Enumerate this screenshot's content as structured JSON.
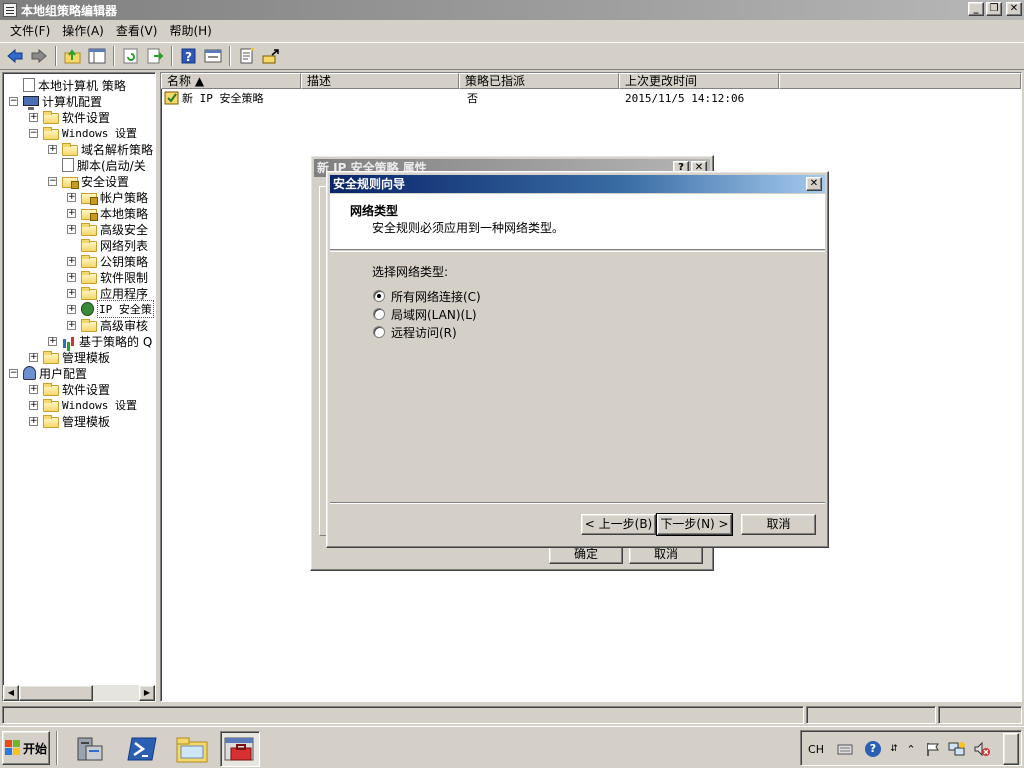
{
  "window": {
    "title": "本地组策略编辑器",
    "minimize": "_",
    "restore": "❐",
    "close": "✕"
  },
  "menu": [
    "文件(F)",
    "操作(A)",
    "查看(V)",
    "帮助(H)"
  ],
  "toolbar": {
    "buttons": [
      "back-icon",
      "forward-icon",
      "up-folder-icon",
      "show-hide-tree-icon",
      "refresh-icon",
      "export-icon",
      "help-icon",
      "properties-icon",
      "new-policy-icon",
      "assign-icon"
    ],
    "colors": {
      "blue": "#2f6ccc",
      "green": "#2aa02a",
      "yellow": "#f5d86a"
    }
  },
  "tree": [
    {
      "label": "本地计算机 策略",
      "icon": "doc-icon",
      "level": 0,
      "expander": ""
    },
    {
      "label": "计算机配置",
      "icon": "computer-icon",
      "level": 0,
      "expander": "−"
    },
    {
      "label": "软件设置",
      "icon": "folder-icon",
      "level": 1,
      "expander": "+"
    },
    {
      "label": "Windows 设置",
      "icon": "folder-icon",
      "level": 1,
      "expander": "−"
    },
    {
      "label": "域名解析策略",
      "icon": "folder-icon",
      "level": 2,
      "expander": "+"
    },
    {
      "label": "脚本(启动/关",
      "icon": "script-icon",
      "level": 2,
      "expander": ""
    },
    {
      "label": "安全设置",
      "icon": "security-folder-icon",
      "level": 2,
      "expander": "−"
    },
    {
      "label": "帐户策略",
      "icon": "security-folder-icon",
      "level": 3,
      "expander": "+"
    },
    {
      "label": "本地策略",
      "icon": "security-folder-icon",
      "level": 3,
      "expander": "+"
    },
    {
      "label": "高级安全",
      "icon": "folder-icon",
      "level": 3,
      "expander": "+"
    },
    {
      "label": "网络列表",
      "icon": "folder-icon",
      "level": 3,
      "expander": ""
    },
    {
      "label": "公钥策略",
      "icon": "folder-icon",
      "level": 3,
      "expander": "+"
    },
    {
      "label": "软件限制",
      "icon": "folder-icon",
      "level": 3,
      "expander": "+"
    },
    {
      "label": "应用程序",
      "icon": "folder-icon",
      "level": 3,
      "expander": "+"
    },
    {
      "label": "IP 安全策",
      "icon": "ip-security-icon",
      "level": 3,
      "expander": "+",
      "selected": true
    },
    {
      "label": "高级审核",
      "icon": "folder-icon",
      "level": 3,
      "expander": "+"
    },
    {
      "label": "基于策略的 Q",
      "icon": "chart-icon",
      "level": 2,
      "expander": "+"
    },
    {
      "label": "管理模板",
      "icon": "folder-icon",
      "level": 1,
      "expander": "+"
    },
    {
      "label": "用户配置",
      "icon": "user-icon",
      "level": 0,
      "expander": "−"
    },
    {
      "label": "软件设置",
      "icon": "folder-icon",
      "level": 1,
      "expander": "+"
    },
    {
      "label": "Windows 设置",
      "icon": "folder-icon",
      "level": 1,
      "expander": "+"
    },
    {
      "label": "管理模板",
      "icon": "folder-icon",
      "level": 1,
      "expander": "+"
    }
  ],
  "list": {
    "columns": [
      "名称 ▲",
      "描述",
      "策略已指派",
      "上次更改时间"
    ],
    "rows": [
      {
        "name": "新 IP 安全策略",
        "description": "",
        "assigned": "否",
        "modified": "2015/11/5 14:12:06"
      }
    ]
  },
  "scrollbar": {
    "left": "◀",
    "right": "▶"
  },
  "properties_dialog": {
    "title": "新 IP 安全策略 属性",
    "help": "?",
    "close": "✕",
    "ok": "确定",
    "cancel": "取消"
  },
  "wizard": {
    "title": "安全规则向导",
    "close": "✕",
    "header_title": "网络类型",
    "header_subtitle": "安全规则必须应用到一种网络类型。",
    "prompt": "选择网络类型:",
    "options": [
      {
        "label": "所有网络连接(C)",
        "checked": true
      },
      {
        "label": "局域网(LAN)(L)",
        "checked": false
      },
      {
        "label": "远程访问(R)",
        "checked": false
      }
    ],
    "back": "< 上一步(B)",
    "next": "下一步(N) >",
    "cancel": "取消"
  },
  "taskbar": {
    "start": "开始",
    "apps": [
      "server-manager-icon",
      "powershell-icon",
      "explorer-icon",
      "group-policy-icon"
    ],
    "tray": {
      "lang": "CH",
      "keyboard": "keyboard-icon",
      "help": "?",
      "expand": "⌃",
      "icons": [
        "flag-icon",
        "network-icon",
        "volume-muted-icon",
        "show-desktop"
      ]
    }
  }
}
